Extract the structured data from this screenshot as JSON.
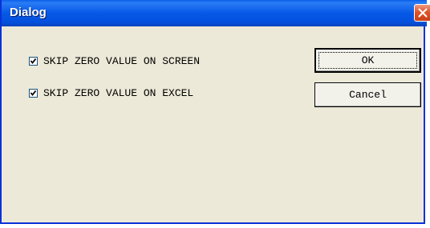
{
  "window": {
    "title": "Dialog"
  },
  "options": [
    {
      "label": "SKIP ZERO VALUE ON SCREEN",
      "checked": true
    },
    {
      "label": "SKIP ZERO VALUE ON EXCEL",
      "checked": true
    }
  ],
  "buttons": {
    "ok_label": "OK",
    "cancel_label": "Cancel"
  },
  "colors": {
    "titlebar": "#0758e6",
    "window_bg": "#ece9d8",
    "close_button": "#e0542a"
  },
  "icons": {
    "close": "close-icon",
    "check": "checkmark-icon"
  }
}
